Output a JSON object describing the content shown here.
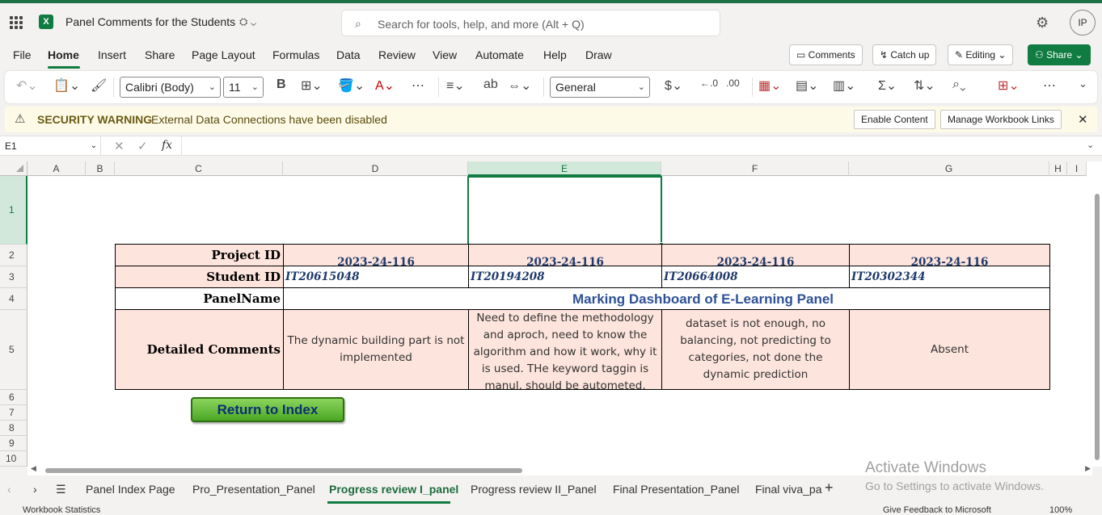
{
  "app": {
    "title": "Panel Comments for the Students",
    "user_initials": "IP",
    "accent": "#107c41"
  },
  "search": {
    "placeholder": "Search for tools, help, and more (Alt + Q)"
  },
  "menu": {
    "items": [
      "File",
      "Home",
      "Insert",
      "Share",
      "Page Layout",
      "Formulas",
      "Data",
      "Review",
      "View",
      "Automate",
      "Help",
      "Draw"
    ],
    "active": "Home",
    "comments": "Comments",
    "catchup": "Catch up",
    "editing": "Editing",
    "share": "Share"
  },
  "ribbon": {
    "font": "Calibri (Body)",
    "size": "11",
    "format": "General"
  },
  "security": {
    "title": "SECURITY WARNING",
    "message": "External Data Connections have been disabled",
    "enable": "Enable Content",
    "manage": "Manage Workbook Links"
  },
  "formula": {
    "namebox": "E1",
    "fx": "fx",
    "value": ""
  },
  "columns": [
    "A",
    "B",
    "C",
    "D",
    "E",
    "F",
    "G",
    "H",
    "I"
  ],
  "selected_column": "E",
  "rows": [
    "1",
    "2",
    "3",
    "4",
    "5",
    "6",
    "7",
    "8",
    "9",
    "10"
  ],
  "sheet": {
    "labels": {
      "project_id": "Project ID",
      "student_id": "Student ID",
      "panel_name": "PanelName",
      "detailed_comments": "Detailed Comments"
    },
    "project_ids": [
      "2023-24-116",
      "2023-24-116",
      "2023-24-116",
      "2023-24-116"
    ],
    "student_ids": [
      "IT20615048",
      "IT20194208",
      "IT20664008",
      "IT20302344"
    ],
    "dashboard_title": "Marking Dashboard of E-Learning Panel",
    "comments": [
      "The dynamic building part is not implemented",
      "Need to define the methodology and aproch, need to know the algorithm and how it work, why it is used. THe keyword taggin is manul, should be autometed,",
      "dataset is not enough, no balancing, not predicting to categories, not done the dynamic prediction",
      "Absent"
    ],
    "return_button": "Return to Index"
  },
  "tabs": {
    "items": [
      "Panel Index Page",
      "Pro_Presentation_Panel",
      "Progress review I_panel",
      "Progress review II_Panel",
      "Final Presentation_Panel",
      "Final viva_pa"
    ],
    "active": "Progress review I_panel"
  },
  "watermark": {
    "line1": "Activate Windows",
    "line2": "Go to Settings to activate Windows."
  },
  "status": {
    "left": "Workbook Statistics",
    "feedback": "Give Feedback to Microsoft",
    "zoom": "100%"
  }
}
